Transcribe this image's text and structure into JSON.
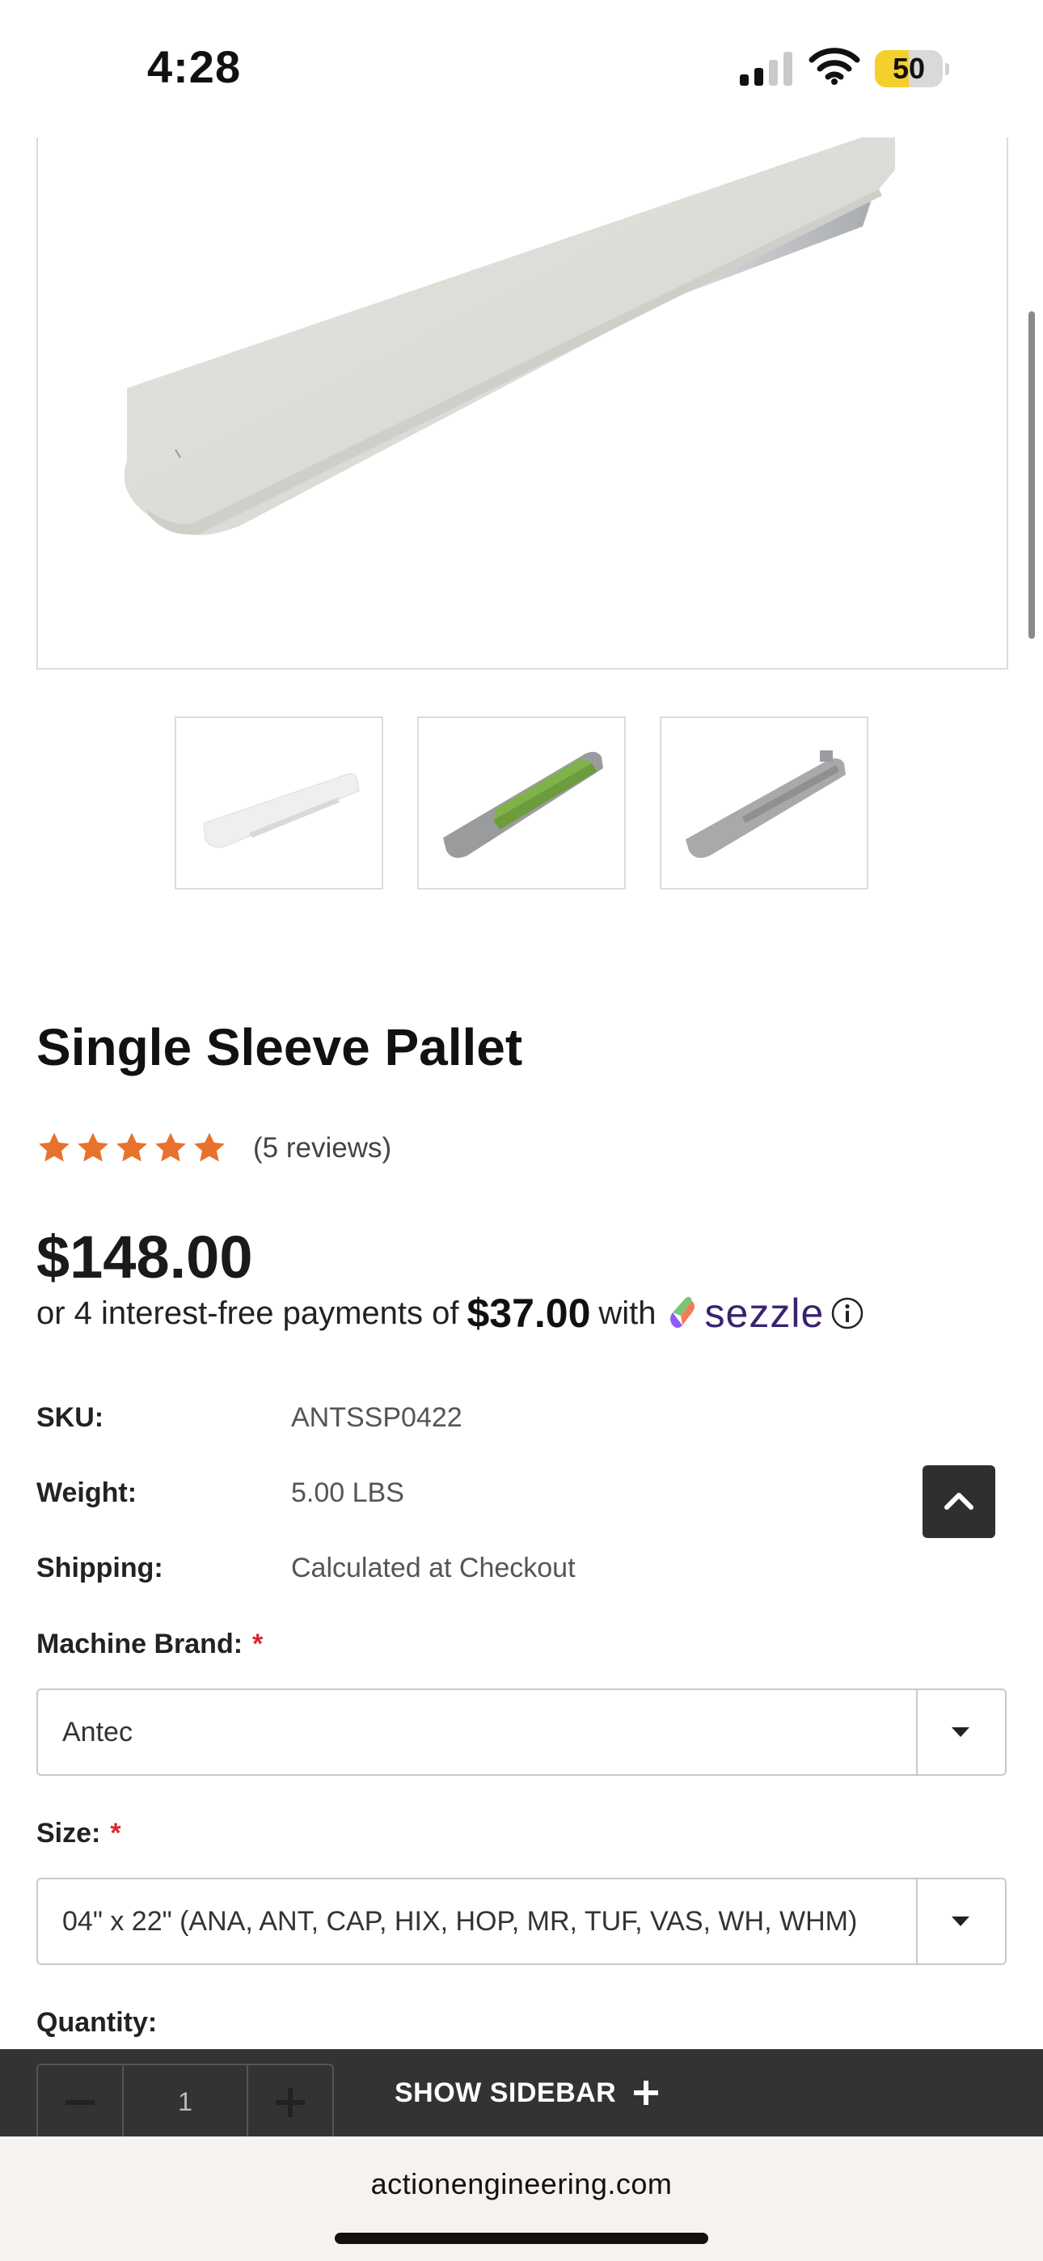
{
  "status_bar": {
    "time": "4:28",
    "battery": "50",
    "battery_level": 0.5,
    "battery_color": "#f5cf2b"
  },
  "product": {
    "title": "Single Sleeve Pallet",
    "rating": 5,
    "reviews": "(5 reviews)",
    "price": "$148.00",
    "installment": {
      "prefix": "or 4 interest-free payments of",
      "amount": "$37.00",
      "with": "with",
      "provider": "sezzle"
    },
    "thumbnails": [
      {
        "icon": "white-pallet-thumbnail"
      },
      {
        "icon": "green-pallet-thumbnail"
      },
      {
        "icon": "gray-pallet-thumbnail"
      }
    ]
  },
  "specs": [
    {
      "label": "SKU:",
      "value": "ANTSSP0422"
    },
    {
      "label": "Weight:",
      "value": "5.00 LBS"
    },
    {
      "label": "Shipping:",
      "value": "Calculated at Checkout"
    }
  ],
  "options": {
    "machine_brand": {
      "label": "Machine Brand:",
      "required_mark": "*",
      "value": "Antec"
    },
    "size": {
      "label": "Size:",
      "required_mark": "*",
      "value": "04\" x 22\" (ANA, ANT, CAP, HIX, HOP, MR, TUF, VAS, WH, WHM)"
    },
    "quantity": {
      "label": "Quantity:",
      "value": "1"
    }
  },
  "sidebar_toggle": {
    "label": "SHOW SIDEBAR"
  },
  "browser": {
    "url": "actionengineering.com"
  },
  "colors": {
    "star": "#e8722c",
    "required": "#d9262c",
    "sezzle": "#3a2270",
    "bottom_bar": "#333333"
  }
}
